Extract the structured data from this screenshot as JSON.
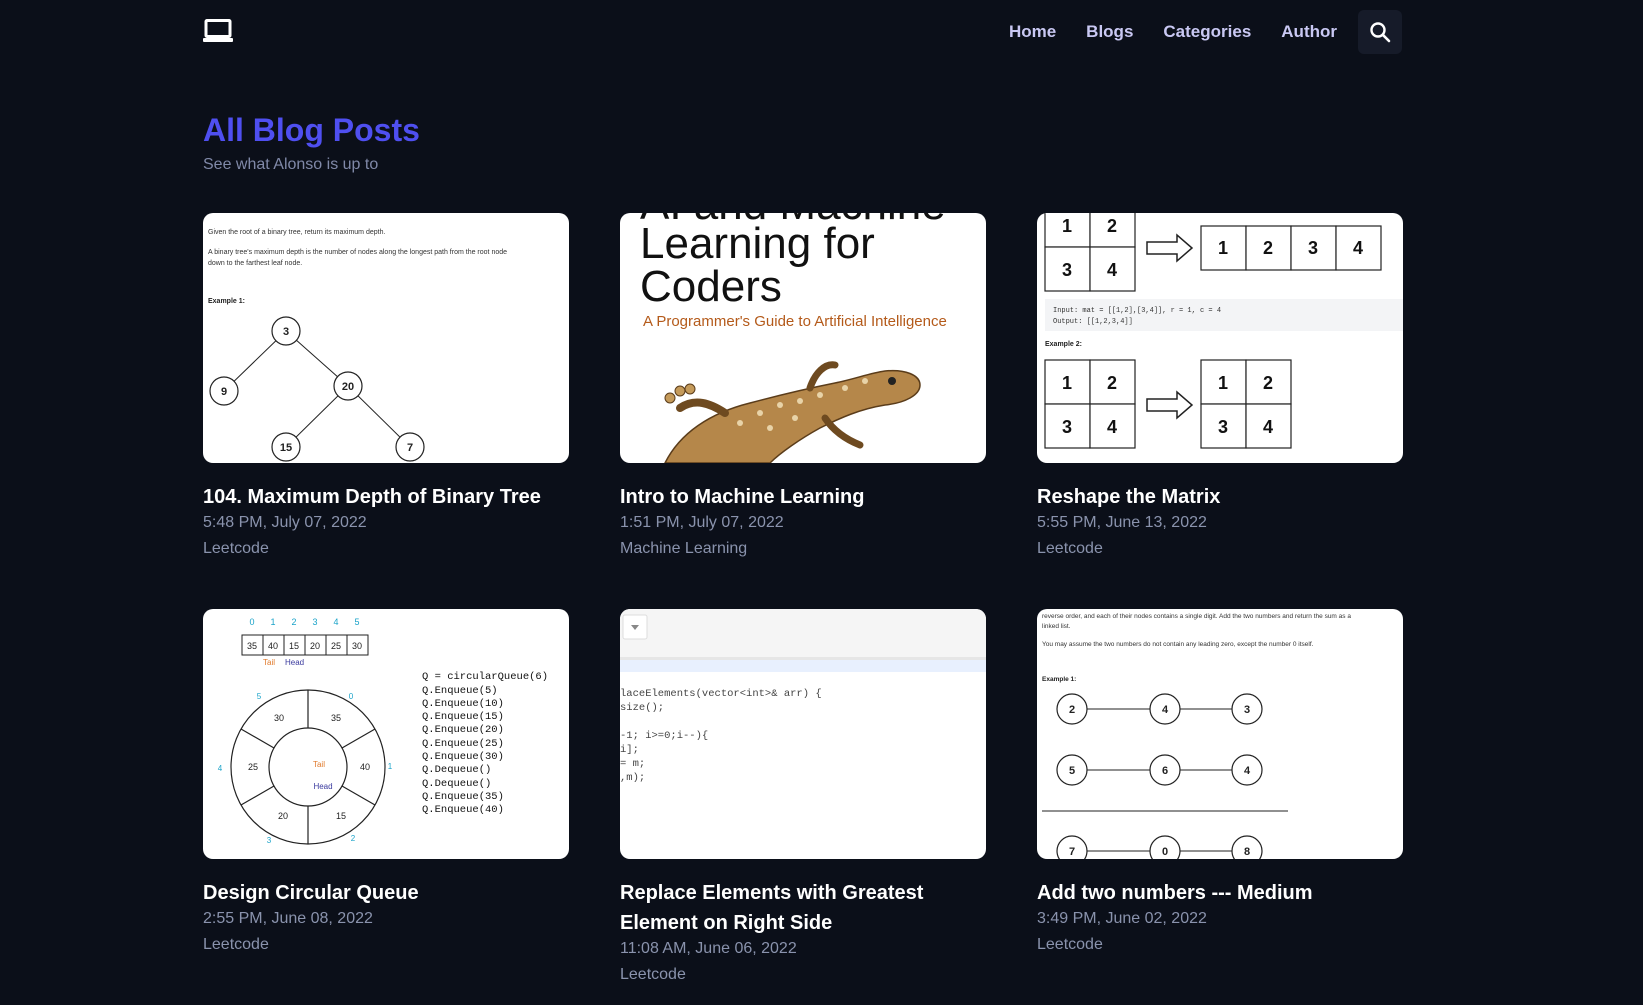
{
  "nav": {
    "links": [
      "Home",
      "Blogs",
      "Categories",
      "Author"
    ]
  },
  "header": {
    "title": "All Blog Posts",
    "subtitle": "See what Alonso is up to"
  },
  "posts": [
    {
      "title": "104. Maximum Depth of Binary Tree",
      "date": "5:48 PM, July 07, 2022",
      "category": "Leetcode",
      "thumb": {
        "intro": "Given the root of a binary tree, return its maximum depth.",
        "desc1": "A binary tree's maximum depth is the number of nodes along the longest path from the root node",
        "desc2": "down to the farthest leaf node.",
        "example": "Example 1:",
        "nodes": [
          "3",
          "9",
          "20",
          "15",
          "7"
        ]
      }
    },
    {
      "title": "Intro to Machine Learning",
      "date": "1:51 PM, July 07, 2022",
      "category": "Machine Learning",
      "thumb": {
        "line0": "AI and Machine",
        "line1": "Learning for",
        "line2": "Coders",
        "tagline": "A Programmer's Guide to Artificial Intelligence"
      }
    },
    {
      "title": "Reshape the Matrix",
      "date": "5:55 PM, June 13, 2022",
      "category": "Leetcode",
      "thumb": {
        "cells": [
          "1",
          "2",
          "3",
          "4"
        ],
        "input": "Input: mat = [[1,2],[3,4]], r = 1, c = 4",
        "output": "Output: [[1,2,3,4]]",
        "example": "Example 2:"
      }
    },
    {
      "title": "Design Circular Queue",
      "date": "2:55 PM, June 08, 2022",
      "category": "Leetcode",
      "thumb": {
        "indices": [
          "0",
          "1",
          "2",
          "3",
          "4",
          "5"
        ],
        "values": [
          "35",
          "40",
          "15",
          "20",
          "25",
          "30"
        ],
        "tail": "Tail",
        "head": "Head",
        "code": [
          "Q = circularQueue(6)",
          "Q.Enqueue(5)",
          "Q.Enqueue(10)",
          "Q.Enqueue(15)",
          "Q.Enqueue(20)",
          "Q.Enqueue(25)",
          "Q.Enqueue(30)",
          "Q.Dequeue()",
          "Q.Dequeue()",
          "Q.Enqueue(35)",
          "Q.Enqueue(40)"
        ]
      }
    },
    {
      "title": "Replace Elements with Greatest Element on Right Side",
      "date": "11:08 AM, June 06, 2022",
      "category": "Leetcode",
      "thumb": {
        "code": [
          "laceElements(vector<int>& arr) {",
          "size();",
          "",
          "-1; i>=0;i--){",
          "i];",
          "= m;",
          ",m);"
        ]
      }
    },
    {
      "title": "Add two numbers --- Medium",
      "date": "3:49 PM, June 02, 2022",
      "category": "Leetcode",
      "thumb": {
        "intro": "reverse order, and each of their nodes contains a single digit. Add the two numbers and return the sum as a",
        "intro2": "linked list.",
        "note": "You may assume the two numbers do not contain any leading zero, except the number 0 itself.",
        "example": "Example 1:",
        "rows": [
          [
            "2",
            "4",
            "3"
          ],
          [
            "5",
            "6",
            "4"
          ],
          [
            "7",
            "0",
            "8"
          ]
        ]
      }
    }
  ]
}
